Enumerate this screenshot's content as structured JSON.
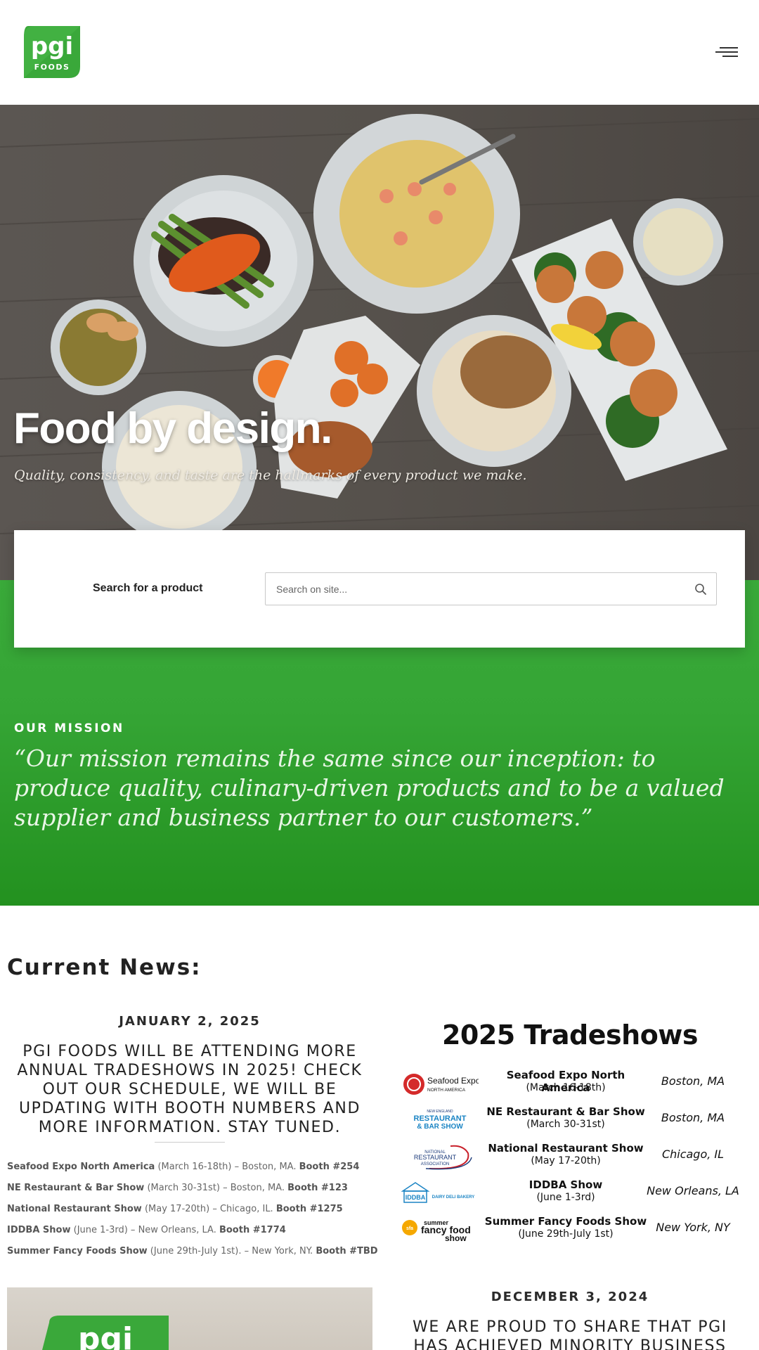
{
  "brand": {
    "logo_text": "pgi",
    "logo_subtext": "FOODS",
    "green": "#3aaa3a"
  },
  "header": {
    "menu_icon": "hamburger-menu-icon"
  },
  "hero": {
    "title": "Food by design.",
    "subtitle": "Quality, consistency, and taste are the hallmarks of every product we make."
  },
  "search": {
    "label": "Search for a product",
    "placeholder": "Search on site...",
    "icon": "search-icon"
  },
  "mission": {
    "label": "OUR MISSION",
    "quote": "“Our mission remains the same since our inception: to produce quality, culinary-driven products and to be a valued supplier and business partner to our customers.”"
  },
  "news": {
    "heading": "Current News:",
    "post1": {
      "date": "JANUARY 2, 2025",
      "title": "PGI FOODS WILL BE ATTENDING MORE ANNUAL TRADESHOWS IN 2025! CHECK OUT OUR SCHEDULE, WE WILL BE UPDATING WITH BOOTH NUMBERS AND MORE INFORMATION. STAY TUNED.",
      "shows": [
        {
          "name": "Seafood Expo North America",
          "detail": " (March 16-18th) – Boston, MA. ",
          "booth": "Booth #254"
        },
        {
          "name": "NE Restaurant & Bar Show",
          "detail": " (March 30-31st) – Boston, MA. ",
          "booth": "Booth #123"
        },
        {
          "name": "National Restaurant Show",
          "detail": " (May 17-20th) – Chicago, IL. ",
          "booth": "Booth #1275"
        },
        {
          "name": "IDDBA Show",
          "detail": " (June 1-3rd) – New Orleans, LA. ",
          "booth": "Booth #1774"
        },
        {
          "name": "Summer Fancy Foods Show",
          "detail": " (June 29th-July 1st). – New York, NY. ",
          "booth": "Booth #TBD"
        }
      ]
    },
    "tradeshows_graphic": {
      "title": "2025 Tradeshows",
      "rows": [
        {
          "logo": "Seafood Expo",
          "logo_sub": "NORTH AMERICA",
          "name": "Seafood Expo North America",
          "dates": "(March 16-18th)",
          "city": "Boston, MA"
        },
        {
          "logo": "RESTAURANT",
          "logo_sub": "& BAR SHOW",
          "name": "NE Restaurant & Bar Show",
          "dates": "(March 30-31st)",
          "city": "Boston, MA"
        },
        {
          "logo": "RESTAURANT",
          "logo_sub": "ASSOCIATION",
          "name": "National Restaurant Show",
          "dates": "(May 17-20th)",
          "city": "Chicago, IL"
        },
        {
          "logo": "IDDBA",
          "logo_sub": "DAIRY DELI BAKERY",
          "name": "IDDBA Show",
          "dates": "(June 1-3rd)",
          "city": "New Orleans, LA"
        },
        {
          "logo": "fancy food",
          "logo_sub": "show",
          "name": "Summer Fancy Foods Show",
          "dates": "(June 29th-July 1st)",
          "city": "New York, NY"
        }
      ]
    },
    "post2": {
      "date": "DECEMBER 3, 2024",
      "title": "WE ARE PROUD TO SHARE THAT PGI HAS ACHIEVED MINORITY BUSINESS"
    }
  }
}
